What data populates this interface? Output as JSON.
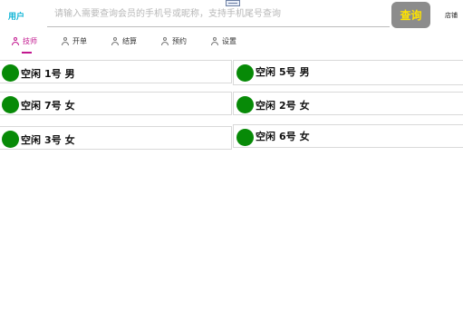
{
  "header": {
    "user_label": "用户",
    "search_placeholder": "请输入需要查询会员的手机号或昵称，支持手机尾号查询",
    "query_button": "查询",
    "store_label": "店铺"
  },
  "tabs": [
    {
      "label": "技师",
      "icon": "person-icon",
      "active": true
    },
    {
      "label": "开单",
      "icon": "person-icon",
      "active": false
    },
    {
      "label": "结算",
      "icon": "person-icon",
      "active": false
    },
    {
      "label": "预约",
      "icon": "person-icon",
      "active": false
    },
    {
      "label": "设置",
      "icon": "person-icon",
      "active": false
    }
  ],
  "technicians": [
    {
      "status": "空闲",
      "number": "1号",
      "gender": "男"
    },
    {
      "status": "空闲",
      "number": "5号",
      "gender": "男"
    },
    {
      "status": "空闲",
      "number": "7号",
      "gender": "女"
    },
    {
      "status": "空闲",
      "number": "2号",
      "gender": "女"
    },
    {
      "status": "空闲",
      "number": "3号",
      "gender": "女"
    },
    {
      "status": "空闲",
      "number": "6号",
      "gender": "女"
    }
  ],
  "colors": {
    "accent": "#c2188f",
    "status_idle": "#078a07",
    "query_bg": "#8c8c8c",
    "query_text": "#ffe400",
    "user_label": "#12b5d6"
  }
}
